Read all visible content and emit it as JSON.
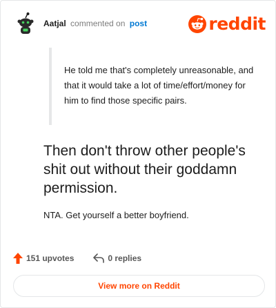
{
  "header": {
    "author": "Aatjal",
    "action_text": "commented on",
    "post_link": "post",
    "brand_word": "reddit"
  },
  "comment": {
    "quote": "He told me that's completely unreasonable, and that it would take a lot of time/effort/money for him to find those specific pairs.",
    "heading": "Then don't throw other people's shit out without their goddamn permission.",
    "body": "NTA. Get yourself a better boyfriend."
  },
  "footer": {
    "upvotes": "151 upvotes",
    "replies": "0 replies",
    "view_more": "View more on Reddit"
  },
  "colors": {
    "brand": "#ff4500",
    "link": "#0079d3",
    "muted": "#7c7c7c"
  },
  "icons": {
    "avatar": "snoo-avatar-icon",
    "logo": "reddit-alien-icon",
    "upvote": "upvote-arrow-icon",
    "reply": "reply-arrow-icon"
  }
}
